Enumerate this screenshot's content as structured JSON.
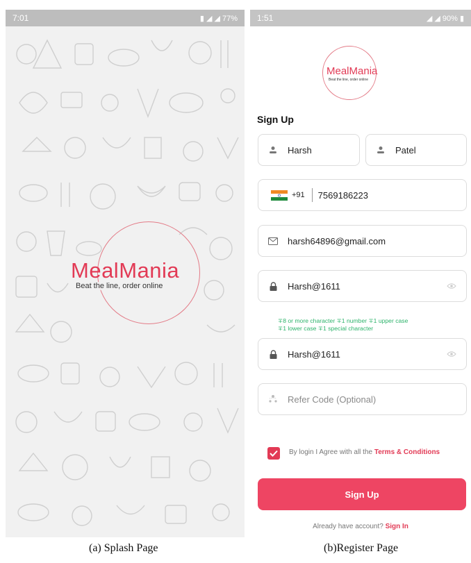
{
  "splash": {
    "status_time": "7:01",
    "status_battery": "77%",
    "brand": "MealMania",
    "tagline": "Beat the line, order online",
    "caption": "(a) Splash Page"
  },
  "register": {
    "status_time": "1:51",
    "status_battery": "90%",
    "brand": "MealMania",
    "tagline": "Beat the line, order online",
    "heading": "Sign Up",
    "first_name": "Harsh",
    "last_name": "Patel",
    "country_code": "+91",
    "phone": "7569186223",
    "email": "harsh64896@gmail.com",
    "password": "Harsh@1611",
    "password_hint_line1": "∓8 or more character ∓1 number ∓1 upper case",
    "password_hint_line2": "∓1 lower case ∓1 special character",
    "confirm_password": "Harsh@1611",
    "refer_placeholder": "Refer Code (Optional)",
    "agree_text": "By login I Agree with all the",
    "terms_link": "Terms & Conditions",
    "agree_checked": true,
    "signup_button": "Sign Up",
    "already_text": "Already have account?",
    "signin_link": "Sign In",
    "caption": "(b)Register Page"
  },
  "colors": {
    "accent": "#e23a55",
    "button": "#ee4563",
    "hint_green": "#2db36b"
  },
  "icons": [
    "person-icon",
    "india-flag-icon",
    "mail-icon",
    "lock-icon",
    "eye-icon",
    "refer-icon",
    "checkmark-icon"
  ]
}
